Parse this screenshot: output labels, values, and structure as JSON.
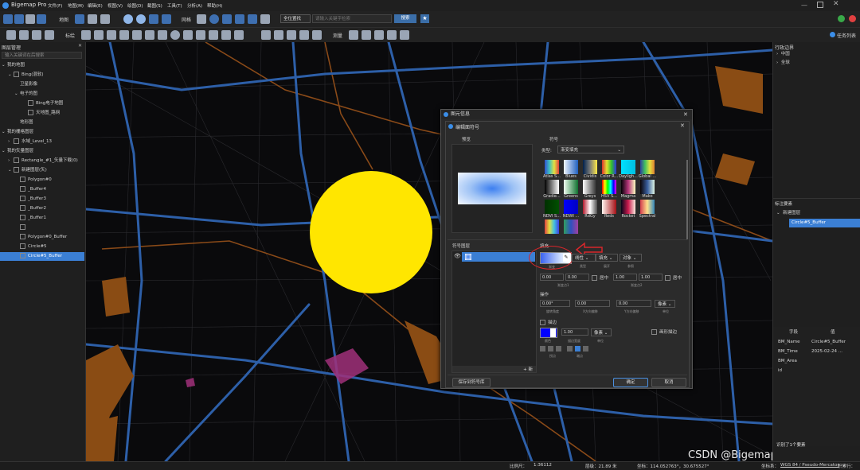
{
  "app": {
    "title": "Bigemap Pro",
    "menu": [
      "文件(F)",
      "地图(M)",
      "编辑(E)",
      "视图(V)",
      "绘图(D)",
      "截图(S)",
      "工具(T)",
      "分析(A)",
      "帮助(H)"
    ]
  },
  "toolbar": {
    "map_label": "地图",
    "grid_label": "网格",
    "search_type": "全位置找",
    "search_placeholder": "请输入关键字检索",
    "search_button": "搜索",
    "label_label": "标绘",
    "measure_label": "测量",
    "task_list": "任务列表"
  },
  "left_panel": {
    "title": "图层管理",
    "search_placeholder": "输入关键词在后搜索",
    "items": [
      {
        "label": "我的地图"
      },
      {
        "label": "Bing(混软)"
      },
      {
        "label": "卫星影像"
      },
      {
        "label": "电子的图"
      },
      {
        "label": "Bing电子地图"
      },
      {
        "label": "天地图_路网"
      },
      {
        "label": "地形图"
      },
      {
        "label": "我的栅格图层"
      },
      {
        "label": "水域_Level_13"
      },
      {
        "label": "我的矢量图层"
      },
      {
        "label": "Rectangle_#1_矢量下载(0)"
      },
      {
        "label": "新建图层(矢)"
      },
      {
        "label": "Polygon#0"
      },
      {
        "label": "_Buffer4"
      },
      {
        "label": "_Buffer3"
      },
      {
        "label": "_Buffer2"
      },
      {
        "label": "_Buffer1"
      },
      {
        "label": ""
      },
      {
        "label": "Polygon#0_Buffer"
      },
      {
        "label": "Circle#5"
      },
      {
        "label": "Circle#5_Buffer"
      }
    ]
  },
  "right_panel": {
    "admin_title": "行政边界",
    "admin_items": [
      "中国",
      "全球"
    ],
    "layer_title": "标注要素",
    "layer_root": "新建图层",
    "layer_child": "Circle#5_Buffer",
    "attr_headers": [
      "字段",
      "值"
    ],
    "attrs": [
      {
        "k": "BM_Name",
        "v": "Circle#5_Buffer"
      },
      {
        "k": "BM_Time",
        "v": "2025-02-24 ..."
      },
      {
        "k": "BM_Area",
        "v": ""
      },
      {
        "k": "id",
        "v": ""
      }
    ],
    "selected_note": "识别了1个要素"
  },
  "status": {
    "scale_label": "比例尺：",
    "scale_value": "1:36112",
    "level": "层级：21.89 米",
    "coords": "坐标：114.052763°，30.675527°",
    "crs_label": "坐标系：",
    "crs_value": "WGS 84 / Pseudo-Mercator",
    "accum_label": "积累行：",
    "watermark": "CSDN @Bigemap软件"
  },
  "outer_dialog": {
    "title": "图元信息"
  },
  "dialog": {
    "title": "编辑面符号",
    "preview_label": "预览",
    "symbol_label": "符号",
    "type_label": "类型:",
    "type_value": "渐变填充",
    "ramps": [
      "Atlas S...",
      "Blues",
      "Cividis",
      "Color R...",
      "Dayligh...",
      "Global ...",
      "Gradie...",
      "Greens",
      "Greys",
      "HSV S...",
      "Magma",
      "Mako",
      "NDVI S...",
      "NDWI ...",
      "RdGy",
      "Reds",
      "Rocket",
      "Spectral",
      "",
      ""
    ],
    "layer_label": "符号图层",
    "fill_section": "填充",
    "gradient_label": "渐变",
    "mode_value": "线性",
    "spread_value": "填充",
    "ref_value": "对象",
    "mode_sub": "类型",
    "spread_sub": "展开",
    "ref_sub": "参照",
    "p1": [
      "0.00",
      "0.00"
    ],
    "p1_center": "居中",
    "p1_sub": "渐变点1",
    "p2": [
      "1.00",
      "1.00"
    ],
    "p2_center": "居中",
    "p2_sub": "渐变点2",
    "ops_label": "操作",
    "rotate": "0.00°",
    "rotate_sub": "旋转角度",
    "offx": "0.00",
    "offx_sub": "X方向偏移",
    "offy": "0.00",
    "offy_sub": "Y方向偏移",
    "unit": "像素",
    "unit_sub": "单位",
    "stroke_label": "描边",
    "stroke_width": "1.00",
    "stroke_unit": "像素",
    "color_sub": "颜色",
    "width_sub": "描边宽度",
    "unit_sub2": "单位",
    "draw_effect": "画形描边",
    "join_sub": "拐点",
    "cap_sub": "端点",
    "save_btn": "保存到符号库",
    "ok_btn": "确定",
    "cancel_btn": "取消",
    "add_btn": "+ 新"
  }
}
